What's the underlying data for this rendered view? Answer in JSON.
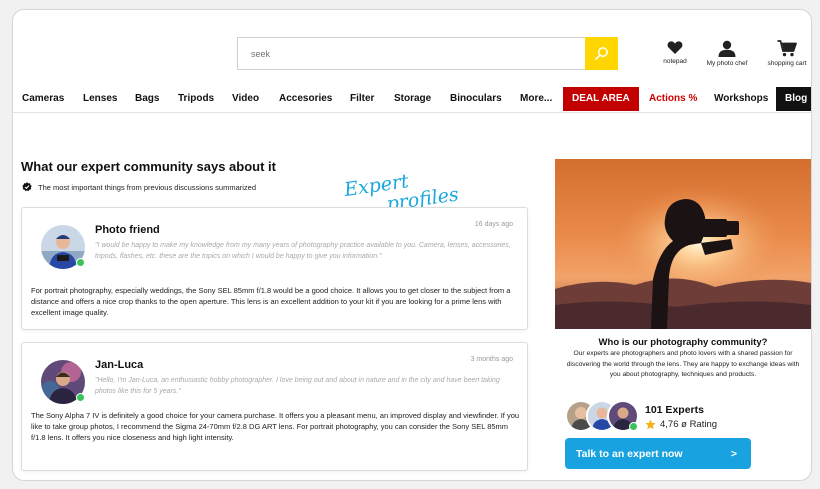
{
  "search": {
    "placeholder": "seek"
  },
  "header_actions": [
    {
      "label": "notepad",
      "icon": "heart-icon"
    },
    {
      "label": "My photo chef",
      "icon": "user-icon"
    },
    {
      "label": "shopping cart",
      "icon": "cart-icon"
    }
  ],
  "nav": {
    "items": [
      "Cameras",
      "Lenses",
      "Bags",
      "Tripods",
      "Video",
      "Accesories",
      "Filter",
      "Storage",
      "Binoculars",
      "More..."
    ],
    "deal": "DEAL AREA",
    "actions": "Actions %",
    "workshops": "Workshops",
    "blog": "Blog"
  },
  "section": {
    "title": "What our expert community says about it",
    "summary": "The most important things from previous discussions summarized",
    "script_label_1": "Expert",
    "script_label_2": "profiles"
  },
  "cards": [
    {
      "name": "Photo friend",
      "time": "16 days ago",
      "quote": "\"I would be happy to make my knowledge from my many years of photography practice available to you. Camera, lenses, accessories, tripods, flashes, etc. these are the topics on which I would be happy to give you information.\"",
      "body": "For portrait photography, especially weddings, the Sony SEL 85mm f/1.8 would be a good choice. It allows you to get closer to the subject from a distance and offers a nice crop thanks to the open aperture. This lens is an excellent addition to your kit if you are looking for a prime lens with excellent image quality."
    },
    {
      "name": "Jan-Luca",
      "time": "3 months ago",
      "quote": "\"Hello, I'm Jan-Luca, an enthusiastic hobby photographer. I love being out and about in nature and in the city and have been taking photos like this for 5 years.\"",
      "body": "The Sony Alpha 7 IV is definitely a good choice for your camera purchase. It offers you a pleasant menu, an improved display and viewfinder. If you like to take group photos, I recommend the Sigma 24-70mm f/2.8 DG ART lens. For portrait photography, you can consider the Sony SEL 85mm f/1.8 lens. It offers you nice closeness and high light intensity."
    }
  ],
  "community": {
    "title": "Who is our photography community?",
    "description": "Our experts are photographers and photo lovers with a shared passion for discovering the world through the lens. They are happy to exchange ideas with you about photography, techniques and products.",
    "experts_count": "101 Experts",
    "rating": "4,76 ø Rating",
    "cta": "Talk to an expert now",
    "cta_arrow": ">"
  },
  "colors": {
    "accent_blue": "#18a3e0",
    "search_yellow": "#ffd600",
    "deal_red": "#c20000",
    "online_green": "#39c35a"
  }
}
